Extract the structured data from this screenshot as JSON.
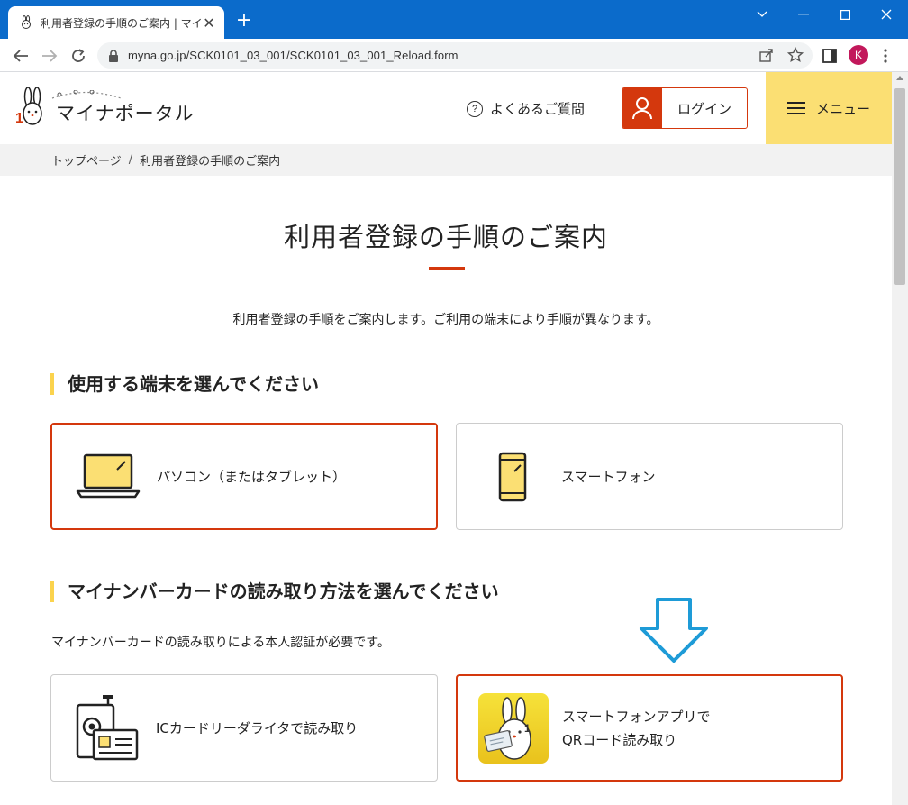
{
  "browser": {
    "tab_title": "利用者登録の手順のご案内 | マイナポータル",
    "url": "myna.go.jp/SCK0101_03_001/SCK0101_03_001_Reload.form",
    "profile_initial": "K"
  },
  "header": {
    "logo_text": "マイナポータル",
    "faq_label": "よくあるご質問",
    "login_label": "ログイン",
    "menu_label": "メニュー"
  },
  "breadcrumb": {
    "home": "トップページ",
    "separator": "/",
    "current": "利用者登録の手順のご案内"
  },
  "main": {
    "title": "利用者登録の手順のご案内",
    "lead": "利用者登録の手順をご案内します。ご利用の端末により手順が異なります。",
    "section1": {
      "heading": "使用する端末を選んでください",
      "options": [
        {
          "label": "パソコン（またはタブレット）",
          "selected": true
        },
        {
          "label": "スマートフォン",
          "selected": false
        }
      ]
    },
    "section2": {
      "heading": "マイナンバーカードの読み取り方法を選んでください",
      "note": "マイナンバーカードの読み取りによる本人認証が必要です。",
      "options": [
        {
          "label": "ICカードリーダライタで読み取り",
          "selected": false
        },
        {
          "label_line1": "スマートフォンアプリで",
          "label_line2": "QRコード読み取り",
          "selected": true
        }
      ]
    }
  },
  "colors": {
    "accent": "#d4380d",
    "yellow": "#fbdf73",
    "browser_blue": "#0b6bcb",
    "arrow_blue": "#1e9bd7"
  }
}
